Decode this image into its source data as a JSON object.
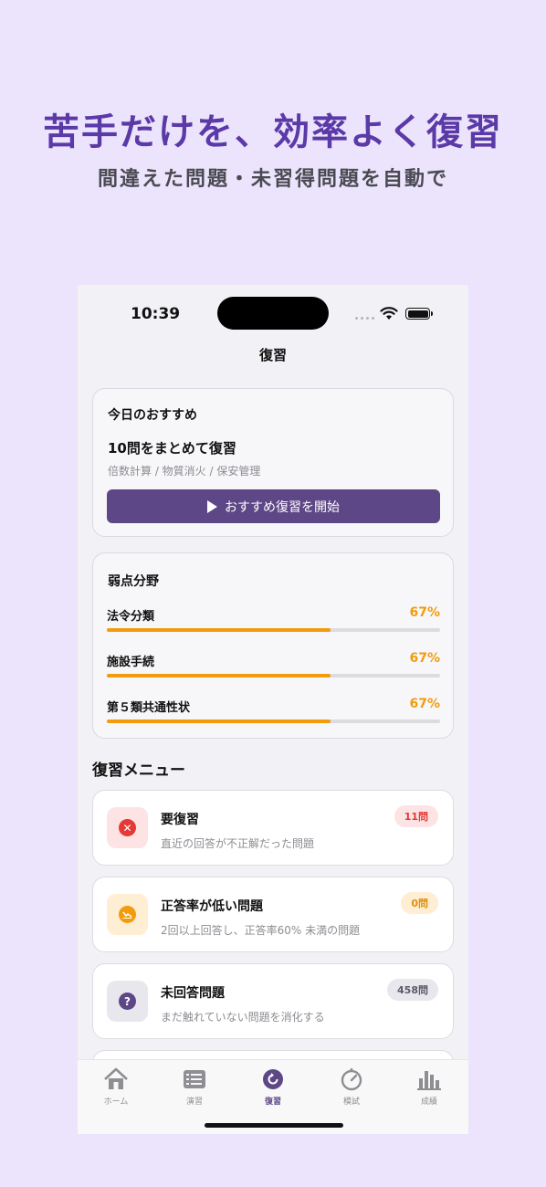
{
  "hero": {
    "title": "苦手だけを、効率よく復習",
    "subtitle": "間違えた問題・未習得問題を自動で"
  },
  "status": {
    "time": "10:39"
  },
  "nav": {
    "title": "復習"
  },
  "recommend": {
    "title": "今日のおすすめ",
    "main": "10問をまとめて復習",
    "sub": "倍数計算 / 物質消火 / 保安管理",
    "button": "おすすめ復習を開始"
  },
  "weak": {
    "title": "弱点分野",
    "items": [
      {
        "name": "法令分類",
        "pct": "67%",
        "value": 0.67
      },
      {
        "name": "施設手続",
        "pct": "67%",
        "value": 0.67
      },
      {
        "name": "第５類共通性状",
        "pct": "67%",
        "value": 0.67
      }
    ]
  },
  "menu": {
    "title": "復習メニュー",
    "items": [
      {
        "title": "要復習",
        "desc": "直近の回答が不正解だった問題",
        "badge": "11問"
      },
      {
        "title": "正答率が低い問題",
        "desc": "2回以上回答し、正答率60% 未満の問題",
        "badge": "0問"
      },
      {
        "title": "未回答問題",
        "desc": "まだ触れていない問題を消化する",
        "badge": "458問"
      }
    ]
  },
  "tabs": [
    {
      "label": "ホーム",
      "icon": "home-icon"
    },
    {
      "label": "演習",
      "icon": "list-icon"
    },
    {
      "label": "復習",
      "icon": "review-icon"
    },
    {
      "label": "模試",
      "icon": "timer-icon"
    },
    {
      "label": "成績",
      "icon": "chart-icon"
    }
  ],
  "colors": {
    "accent": "#5e4786",
    "warning": "#f29b0c",
    "error": "#e53935",
    "heroTitle": "#5b3aa8",
    "background": "#ece4fc"
  }
}
